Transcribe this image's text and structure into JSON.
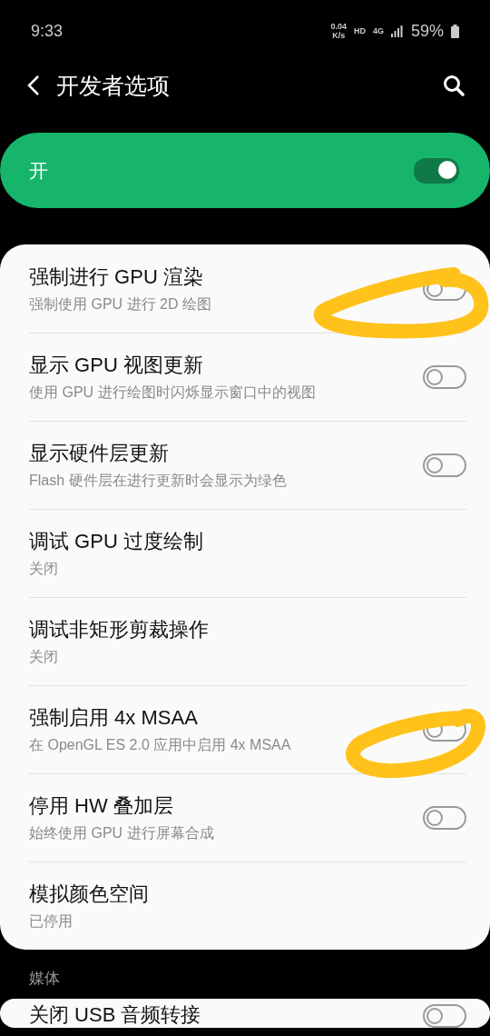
{
  "status_bar": {
    "time": "9:33",
    "speed": "0.04",
    "speed_unit": "K/s",
    "hd": "HD",
    "network": "4G",
    "battery": "59%"
  },
  "header": {
    "title": "开发者选项"
  },
  "master_switch": {
    "label": "开",
    "on": true
  },
  "sections": [
    {
      "items": [
        {
          "kind": "switch",
          "title": "强制进行 GPU 渲染",
          "subtitle": "强制使用 GPU 进行 2D 绘图",
          "on": false
        },
        {
          "kind": "switch",
          "title": "显示 GPU 视图更新",
          "subtitle": "使用 GPU 进行绘图时闪烁显示窗口中的视图",
          "on": false
        },
        {
          "kind": "switch",
          "title": "显示硬件层更新",
          "subtitle": "Flash 硬件层在进行更新时会显示为绿色",
          "on": false
        },
        {
          "kind": "info",
          "title": "调试 GPU 过度绘制",
          "subtitle": "关闭"
        },
        {
          "kind": "info",
          "title": "调试非矩形剪裁操作",
          "subtitle": "关闭"
        },
        {
          "kind": "switch",
          "title": "强制启用 4x MSAA",
          "subtitle": "在 OpenGL ES 2.0 应用中启用 4x MSAA",
          "on": false
        },
        {
          "kind": "switch",
          "title": "停用 HW 叠加层",
          "subtitle": "始终使用 GPU 进行屏幕合成",
          "on": false
        },
        {
          "kind": "info",
          "title": "模拟颜色空间",
          "subtitle": "已停用"
        }
      ]
    },
    {
      "label": "媒体",
      "items": [
        {
          "kind": "switch",
          "title": "关闭 USB 音频转接",
          "on": false
        }
      ]
    }
  ]
}
